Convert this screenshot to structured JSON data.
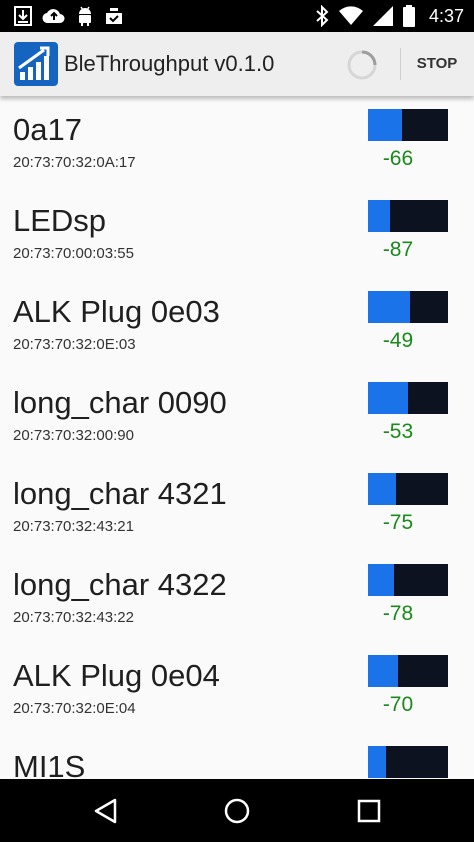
{
  "status_bar": {
    "time": "4:37",
    "icons_left": [
      "download-icon",
      "cloud-upload-icon",
      "android-icon",
      "inbox-check-icon"
    ],
    "icons_right": [
      "bluetooth-icon",
      "wifi-icon",
      "signal-icon",
      "battery-icon"
    ]
  },
  "action_bar": {
    "title": "BleThroughput v0.1.0",
    "stop_label": "STOP"
  },
  "colors": {
    "rssi_fill": "#1a73e8",
    "rssi_bg": "#0d1220",
    "rssi_text": "#1a8a1a"
  },
  "devices": [
    {
      "name": "0a17",
      "address": "20:73:70:32:0A:17",
      "rssi": "-66",
      "signal_fraction": 0.42
    },
    {
      "name": "LEDsp",
      "address": "20:73:70:00:03:55",
      "rssi": "-87",
      "signal_fraction": 0.27
    },
    {
      "name": "ALK Plug 0e03",
      "address": "20:73:70:32:0E:03",
      "rssi": "-49",
      "signal_fraction": 0.52
    },
    {
      "name": "long_char 0090",
      "address": "20:73:70:32:00:90",
      "rssi": "-53",
      "signal_fraction": 0.5
    },
    {
      "name": "long_char 4321",
      "address": "20:73:70:32:43:21",
      "rssi": "-75",
      "signal_fraction": 0.35
    },
    {
      "name": "long_char 4322",
      "address": "20:73:70:32:43:22",
      "rssi": "-78",
      "signal_fraction": 0.33
    },
    {
      "name": "ALK Plug 0e04",
      "address": "20:73:70:32:0E:04",
      "rssi": "-70",
      "signal_fraction": 0.38
    },
    {
      "name": "MI1S",
      "address": "",
      "rssi": "",
      "signal_fraction": 0.22
    }
  ],
  "nav_bar": [
    "back-icon",
    "home-icon",
    "recents-icon"
  ]
}
